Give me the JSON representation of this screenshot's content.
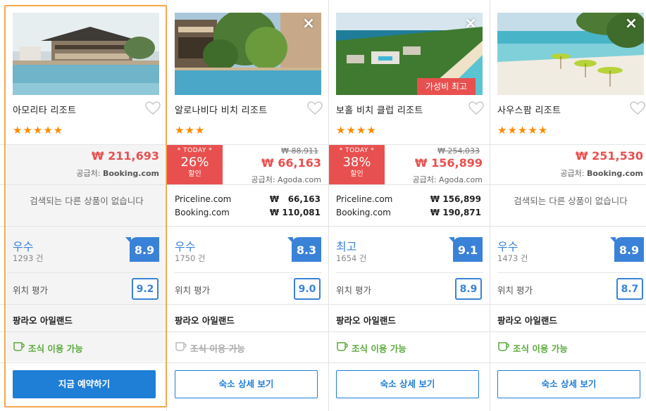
{
  "colors": {
    "accent": "#1f7fd6",
    "price_red": "#e8504f",
    "star_orange": "#ff8a00",
    "breakfast_green": "#5aa93a",
    "selected_border": "#f5a74b"
  },
  "cards": [
    {
      "name": "아모리타 리조트",
      "stars": "★★★★★",
      "price": "₩ 211,693",
      "supplier_label": "공급처:",
      "supplier": "Booking.com",
      "no_other_text": "검색되는 다른 상품이 없습니다",
      "rating_word": "우수",
      "rating_count": "1293 건",
      "score": "8.9",
      "location_label": "위치 평가",
      "location_score": "9.2",
      "area": "팡라오 아일랜드",
      "breakfast": "조식 이용 가능",
      "button": "지금 예약하기"
    },
    {
      "name": "알로나비다 비치 리조트",
      "stars": "★★★",
      "today_label": "* TODAY *",
      "discount": "26%",
      "discount_word": "할인",
      "original_price": "₩ 88,911",
      "price": "₩ 66,163",
      "supplier_label": "공급처:",
      "supplier": "Agoda.com",
      "offers": [
        {
          "site": "Priceline.com",
          "price": "₩   66,163"
        },
        {
          "site": "Booking.com",
          "price": "₩ 110,081"
        }
      ],
      "rating_word": "우수",
      "rating_count": "1750 건",
      "score": "8.3",
      "location_label": "위치 평가",
      "location_score": "9.0",
      "area": "팡라오 아일랜드",
      "breakfast": "조식 이용 가능",
      "button": "숙소 상세 보기"
    },
    {
      "name": "보홀 비치 클럽 리조트",
      "stars": "★★★★",
      "value_badge": "가성비 최고",
      "today_label": "* TODAY *",
      "discount": "38%",
      "discount_word": "할인",
      "original_price": "₩ 254,033",
      "price": "₩ 156,899",
      "supplier_label": "공급처:",
      "supplier": "Agoda.com",
      "offers": [
        {
          "site": "Priceline.com",
          "price": "₩ 156,899"
        },
        {
          "site": "Booking.com",
          "price": "₩ 190,871"
        }
      ],
      "rating_word": "최고",
      "rating_count": "1654 건",
      "score": "9.1",
      "location_label": "위치 평가",
      "location_score": "8.9",
      "area": "팡라오 아일랜드",
      "breakfast": "조식 이용 가능",
      "button": "숙소 상세 보기"
    },
    {
      "name": "사우스팜 리조트",
      "stars": "★★★★★",
      "price": "₩ 251,530",
      "supplier_label": "공급처:",
      "supplier": "Booking.com",
      "no_other_text": "검색되는 다른 상품이 없습니다",
      "rating_word": "우수",
      "rating_count": "1473 건",
      "score": "8.9",
      "location_label": "위치 평가",
      "location_score": "8.7",
      "area": "팡라오 아일랜드",
      "breakfast": "조식 이용 가능",
      "button": "숙소 상세 보기"
    }
  ]
}
